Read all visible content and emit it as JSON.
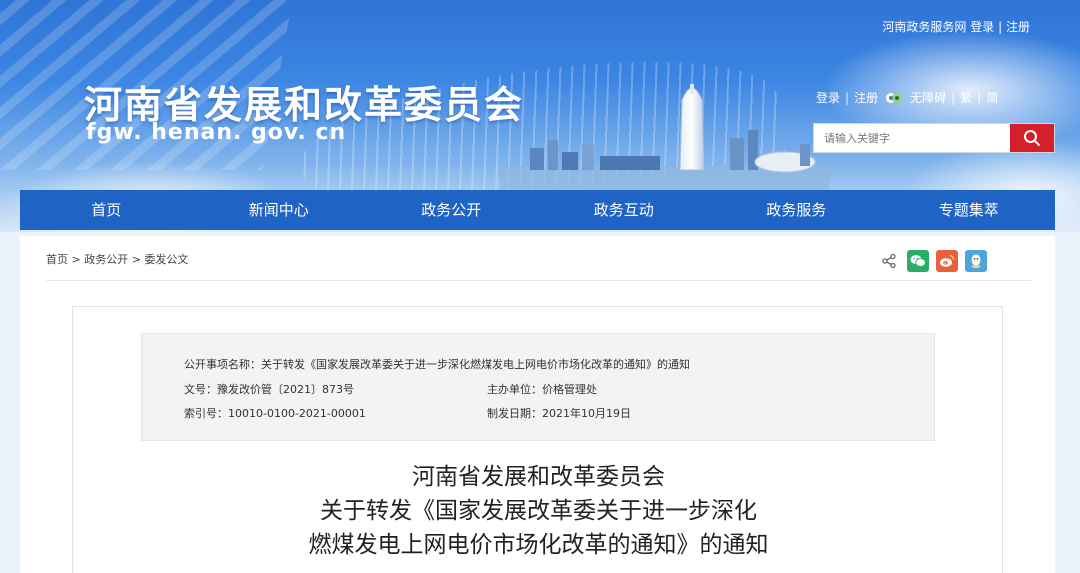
{
  "header": {
    "site_title": "河南省发展和改革委员会",
    "site_domain": "fgw. henan. gov. cn",
    "top_links": {
      "portal": "河南政务服务网",
      "login": "登录",
      "register": "注册",
      "separator": "|"
    },
    "tools": {
      "login": "登录",
      "register": "注册",
      "accessibility": "无障碍",
      "traditional": "繁",
      "simplified": "简",
      "separator": "|"
    },
    "search": {
      "placeholder": "请输入关键字"
    }
  },
  "nav": {
    "items": [
      {
        "label": "首页"
      },
      {
        "label": "新闻中心"
      },
      {
        "label": "政务公开"
      },
      {
        "label": "政务互动"
      },
      {
        "label": "政务服务"
      },
      {
        "label": "专题集萃"
      }
    ]
  },
  "breadcrumb": {
    "items": [
      "首页",
      "政务公开",
      "委发公文"
    ],
    "separator": ">"
  },
  "share": {
    "icons": [
      "share-icon",
      "wechat-icon",
      "weibo-icon",
      "qq-icon"
    ]
  },
  "meta": {
    "item_name_label": "公开事项名称：",
    "item_name_value": "关于转发《国家发展改革委关于进一步深化燃煤发电上网电价市场化改革的通知》的通知",
    "doc_no_label": "文号：",
    "doc_no_value": "豫发改价管〔2021〕873号",
    "dept_label": "主办单位：",
    "dept_value": "价格管理处",
    "index_label": "索引号：",
    "index_value": "10010-0100-2021-00001",
    "date_label": "制发日期：",
    "date_value": "2021年10月19日"
  },
  "document": {
    "title_line1": "河南省发展和改革委员会",
    "title_line2": "关于转发《国家发展改革委关于进一步深化",
    "title_line3": "燃煤发电上网电价市场化改革的通知》的通知"
  },
  "colors": {
    "nav_bg": "#1f64c4",
    "search_button": "#d3202a",
    "wechat": "#2aae67",
    "weibo": "#e8613a",
    "qq": "#4aa6dc"
  }
}
